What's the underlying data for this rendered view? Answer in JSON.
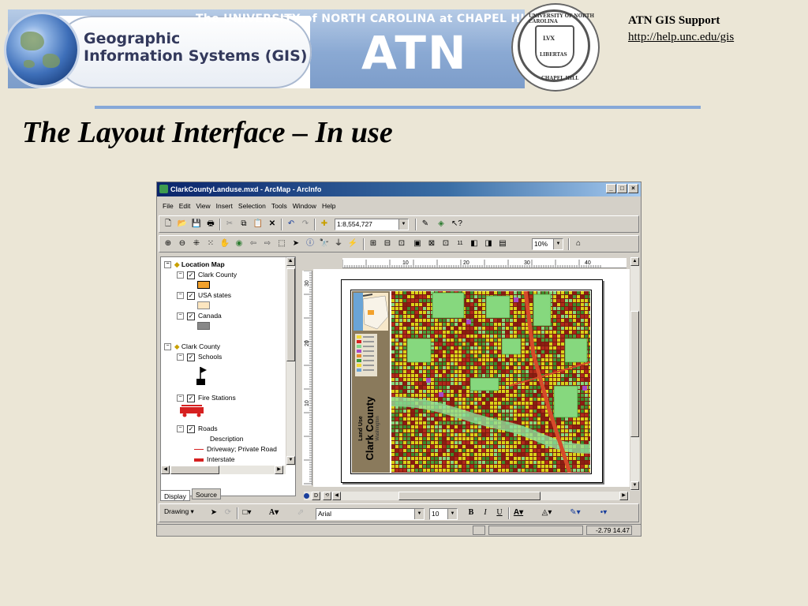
{
  "banner": {
    "gis_line1": "Geographic",
    "gis_line2": "Information Systems (GIS)",
    "university": "The UNIVERSITY of NORTH CAROLINA at CHAPEL HILL",
    "atn": "ATN",
    "seal_text_top": "UNIVERSITY OF NORTH CAROLINA",
    "seal_text_bottom": "CHAPEL HILL",
    "seal_lux": "LVX",
    "seal_libertas": "LIBERTAS"
  },
  "support": {
    "title": "ATN GIS Support",
    "url": "http://help.unc.edu/gis"
  },
  "slide_title": "The Layout Interface – In use",
  "window": {
    "title": "ClarkCountyLanduse.mxd - ArcMap - ArcInfo",
    "menus": [
      "File",
      "Edit",
      "View",
      "Insert",
      "Selection",
      "Tools",
      "Window",
      "Help"
    ],
    "scale": "1:8,554,727",
    "zoom": "10%",
    "font_name": "Arial",
    "font_size": "10",
    "coords": "-2.79  14.47",
    "drawing_label": "Drawing",
    "tabs": [
      "Display",
      "Source"
    ],
    "ruler_h": [
      "10",
      "20",
      "30",
      "40"
    ],
    "ruler_v": [
      "30",
      "20",
      "10"
    ]
  },
  "toc": {
    "location_map": "Location Map",
    "clark_county_layer": "Clark County",
    "usa_states": "USA states",
    "canada": "Canada",
    "clark_county_frame": "Clark County",
    "schools": "Schools",
    "fire_stations": "Fire Stations",
    "roads": "Roads",
    "description": "Description",
    "driveway": "Driveway; Private Road",
    "interstate": "Interstate"
  },
  "map": {
    "side_title": "Clark County",
    "side_sub": "Land Use",
    "side_state": "Washington"
  },
  "colors": {
    "banner_blue": "#8aa9d3",
    "title_bar": "#0a246a",
    "rule": "#86a8d8",
    "background": "#ebe6d6"
  }
}
